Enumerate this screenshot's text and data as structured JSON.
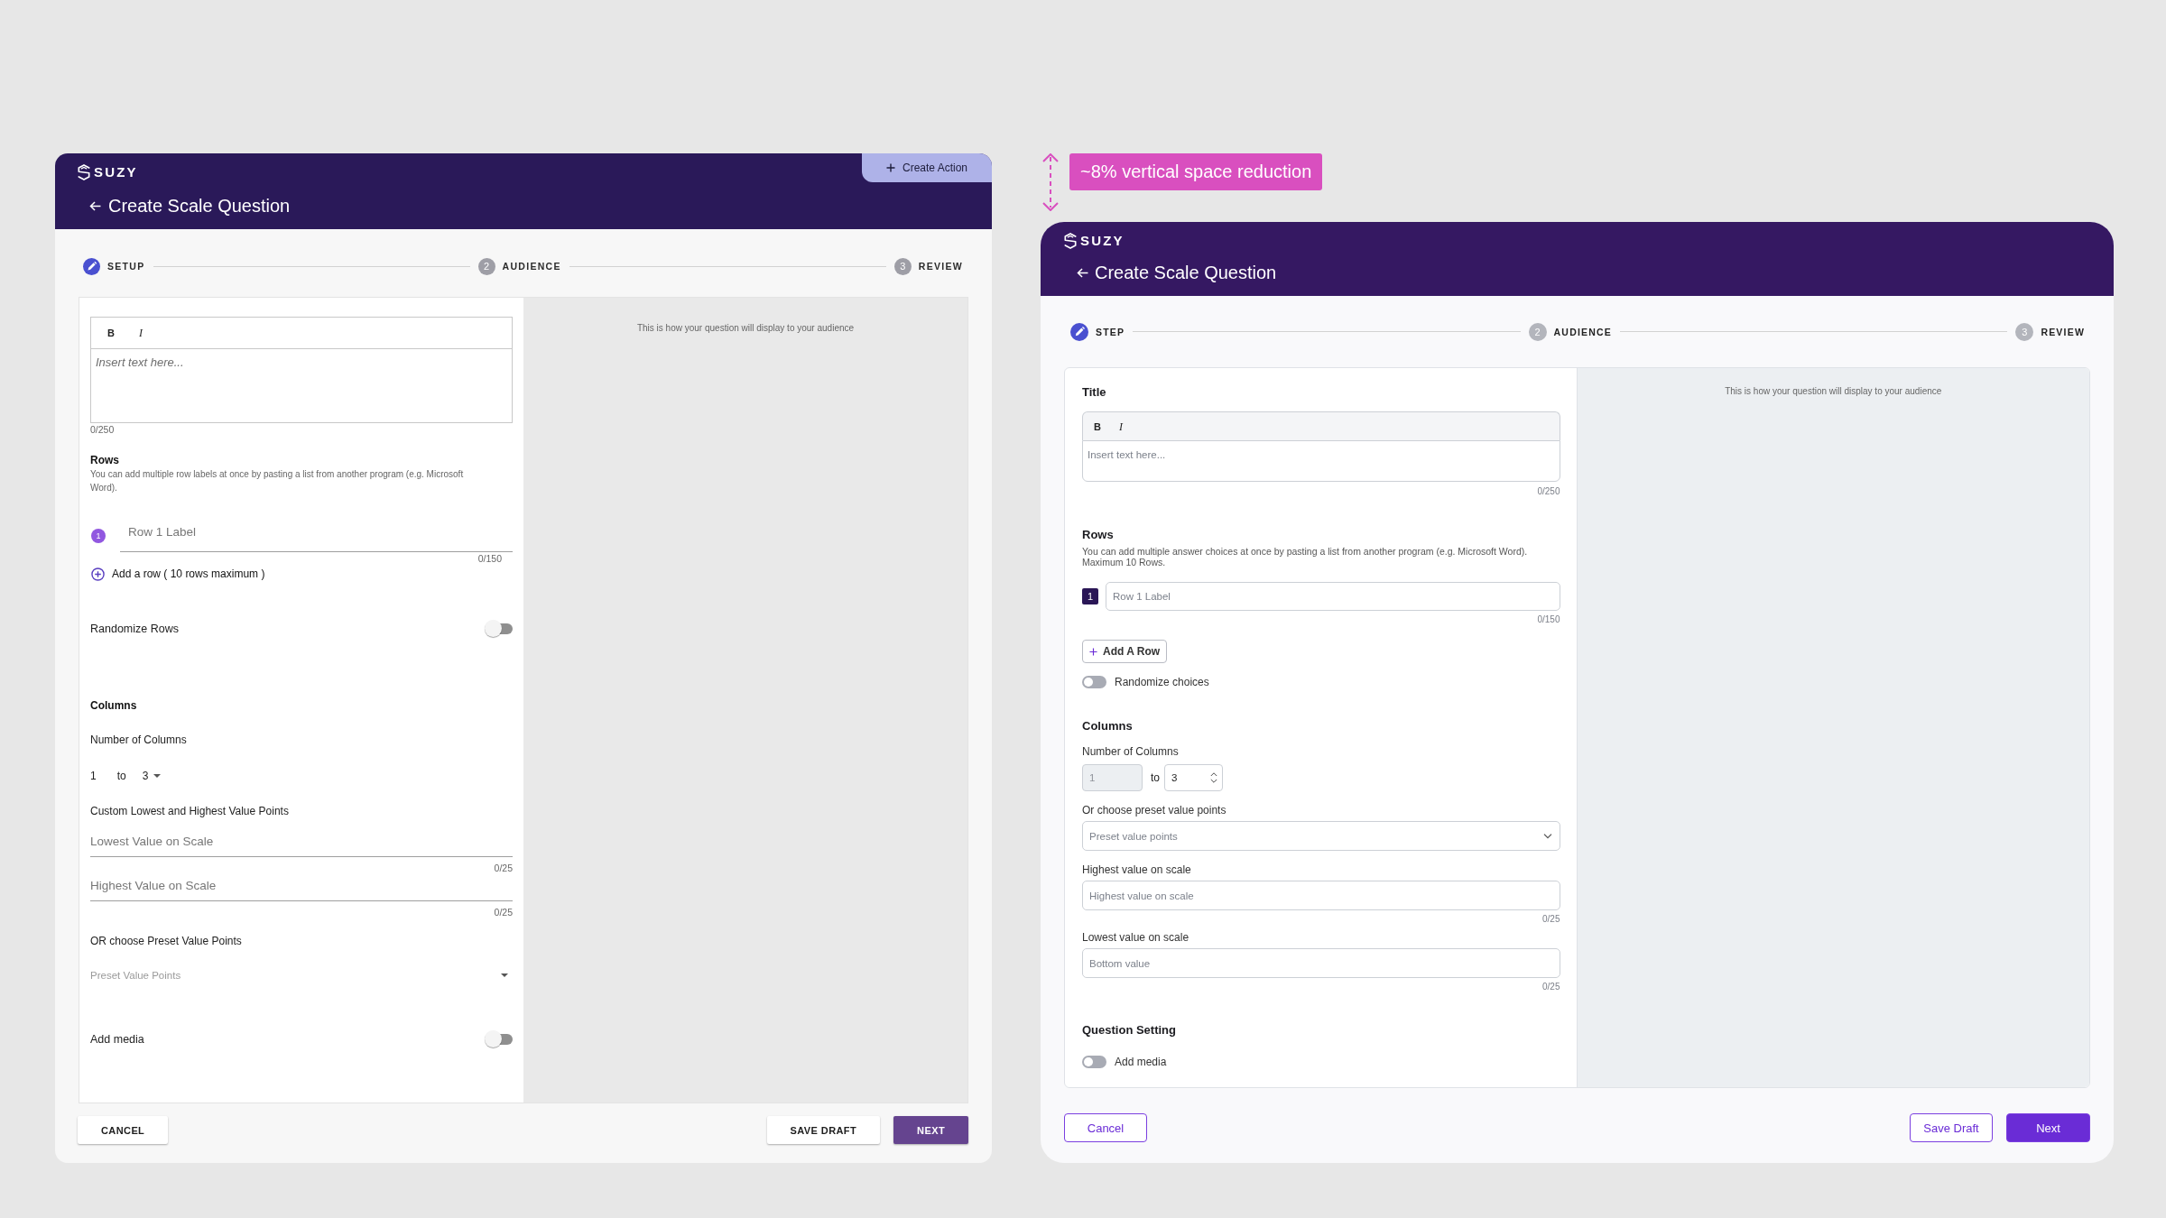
{
  "left_screen": {
    "kind": "legacy",
    "logo": "SUZY",
    "header_action": {
      "label": "Create Action"
    },
    "title": "Create Scale Question",
    "steps": [
      {
        "label": "SETUP",
        "selected": true
      },
      {
        "number": "2",
        "label": "AUDIENCE",
        "selected": false
      },
      {
        "number": "3",
        "label": "REVIEW",
        "selected": false
      }
    ],
    "form": [
      {
        "kind": "editor",
        "toolbar": [
          {
            "label": "B",
            "kind": "bold"
          },
          {
            "label": "I",
            "kind": "italic"
          }
        ],
        "placeholder": "Insert text here...",
        "counter": "0/250"
      },
      {
        "kind": "section",
        "heading": "Rows",
        "help": "You can add multiple row labels at once by pasting a list from another program (e.g. Microsoft Word)."
      },
      {
        "kind": "row_input",
        "number": "1",
        "placeholder": "Row 1 Label",
        "counter": "0/150"
      },
      {
        "kind": "add_row",
        "label": "Add a row ( 10 rows maximum )"
      },
      {
        "kind": "toggle",
        "label": "Randomize Rows",
        "on": false
      },
      {
        "kind": "section",
        "heading": "Columns"
      },
      {
        "kind": "label",
        "text": "Number of Columns"
      },
      {
        "kind": "range",
        "from": {
          "kind": "text",
          "value": "1"
        },
        "separator": "to",
        "to": {
          "kind": "dropdown",
          "value": "3"
        }
      },
      {
        "kind": "label",
        "text": "Custom Lowest and Highest Value Points"
      },
      {
        "kind": "text_field",
        "placeholder": "Lowest Value on Scale",
        "counter": "0/25"
      },
      {
        "kind": "text_field",
        "placeholder": "Highest Value on Scale",
        "counter": "0/25"
      },
      {
        "kind": "label",
        "text": "OR choose Preset Value Points"
      },
      {
        "kind": "select",
        "placeholder": "Preset Value Points"
      },
      {
        "kind": "toggle",
        "label": "Add media",
        "on": false
      }
    ],
    "preview_note": "This is how your question will display to your audience",
    "footer": {
      "buttons": [
        {
          "label": "CANCEL",
          "kind": "cancel"
        },
        {
          "label": "SAVE DRAFT",
          "kind": "save_draft"
        },
        {
          "label": "NEXT",
          "kind": "next"
        }
      ]
    }
  },
  "annotation": {
    "text": "~8% vertical space reduction"
  },
  "right_screen": {
    "kind": "redesign",
    "logo": "SUZY",
    "title": "Create Scale Question",
    "steps": [
      {
        "label": "STEP",
        "selected": true
      },
      {
        "number": "2",
        "label": "AUDIENCE",
        "selected": false
      },
      {
        "number": "3",
        "label": "REVIEW",
        "selected": false
      }
    ],
    "form": [
      {
        "kind": "section",
        "heading": "Title"
      },
      {
        "kind": "editor",
        "toolbar": [
          {
            "label": "B",
            "kind": "bold"
          },
          {
            "label": "I",
            "kind": "italic"
          }
        ],
        "placeholder": "Insert text here...",
        "counter": "0/250"
      },
      {
        "kind": "section",
        "heading": "Rows",
        "help": "You can add multiple answer choices at once by pasting a list from another program (e.g. Microsoft Word). Maximum 10 Rows."
      },
      {
        "kind": "row_input",
        "number": "1",
        "placeholder": "Row 1 Label",
        "counter": "0/150"
      },
      {
        "kind": "add_row",
        "label": "Add A Row"
      },
      {
        "kind": "toggle",
        "label": "Randomize choices",
        "on": false
      },
      {
        "kind": "section",
        "heading": "Columns"
      },
      {
        "kind": "label",
        "text": "Number of Columns"
      },
      {
        "kind": "range",
        "from": {
          "kind": "input",
          "value": "1",
          "disabled": true
        },
        "separator": "to",
        "to": {
          "kind": "stepper",
          "value": "3"
        }
      },
      {
        "kind": "label",
        "text": "Or choose preset value points"
      },
      {
        "kind": "select",
        "placeholder": "Preset value points"
      },
      {
        "kind": "label",
        "text": "Highest value on scale"
      },
      {
        "kind": "text_field",
        "placeholder": "Highest value on scale",
        "counter": "0/25"
      },
      {
        "kind": "label",
        "text": "Lowest value on scale"
      },
      {
        "kind": "text_field",
        "placeholder": "Bottom value",
        "counter": "0/25"
      },
      {
        "kind": "section",
        "heading": "Question Setting"
      },
      {
        "kind": "toggle",
        "label": "Add media",
        "on": false
      }
    ],
    "preview_note": "This is how your question will display to your audience",
    "footer": {
      "buttons": [
        {
          "label": "Cancel",
          "kind": "cancel"
        },
        {
          "label": "Save Draft",
          "kind": "save_draft"
        },
        {
          "label": "Next",
          "kind": "next"
        }
      ]
    }
  }
}
